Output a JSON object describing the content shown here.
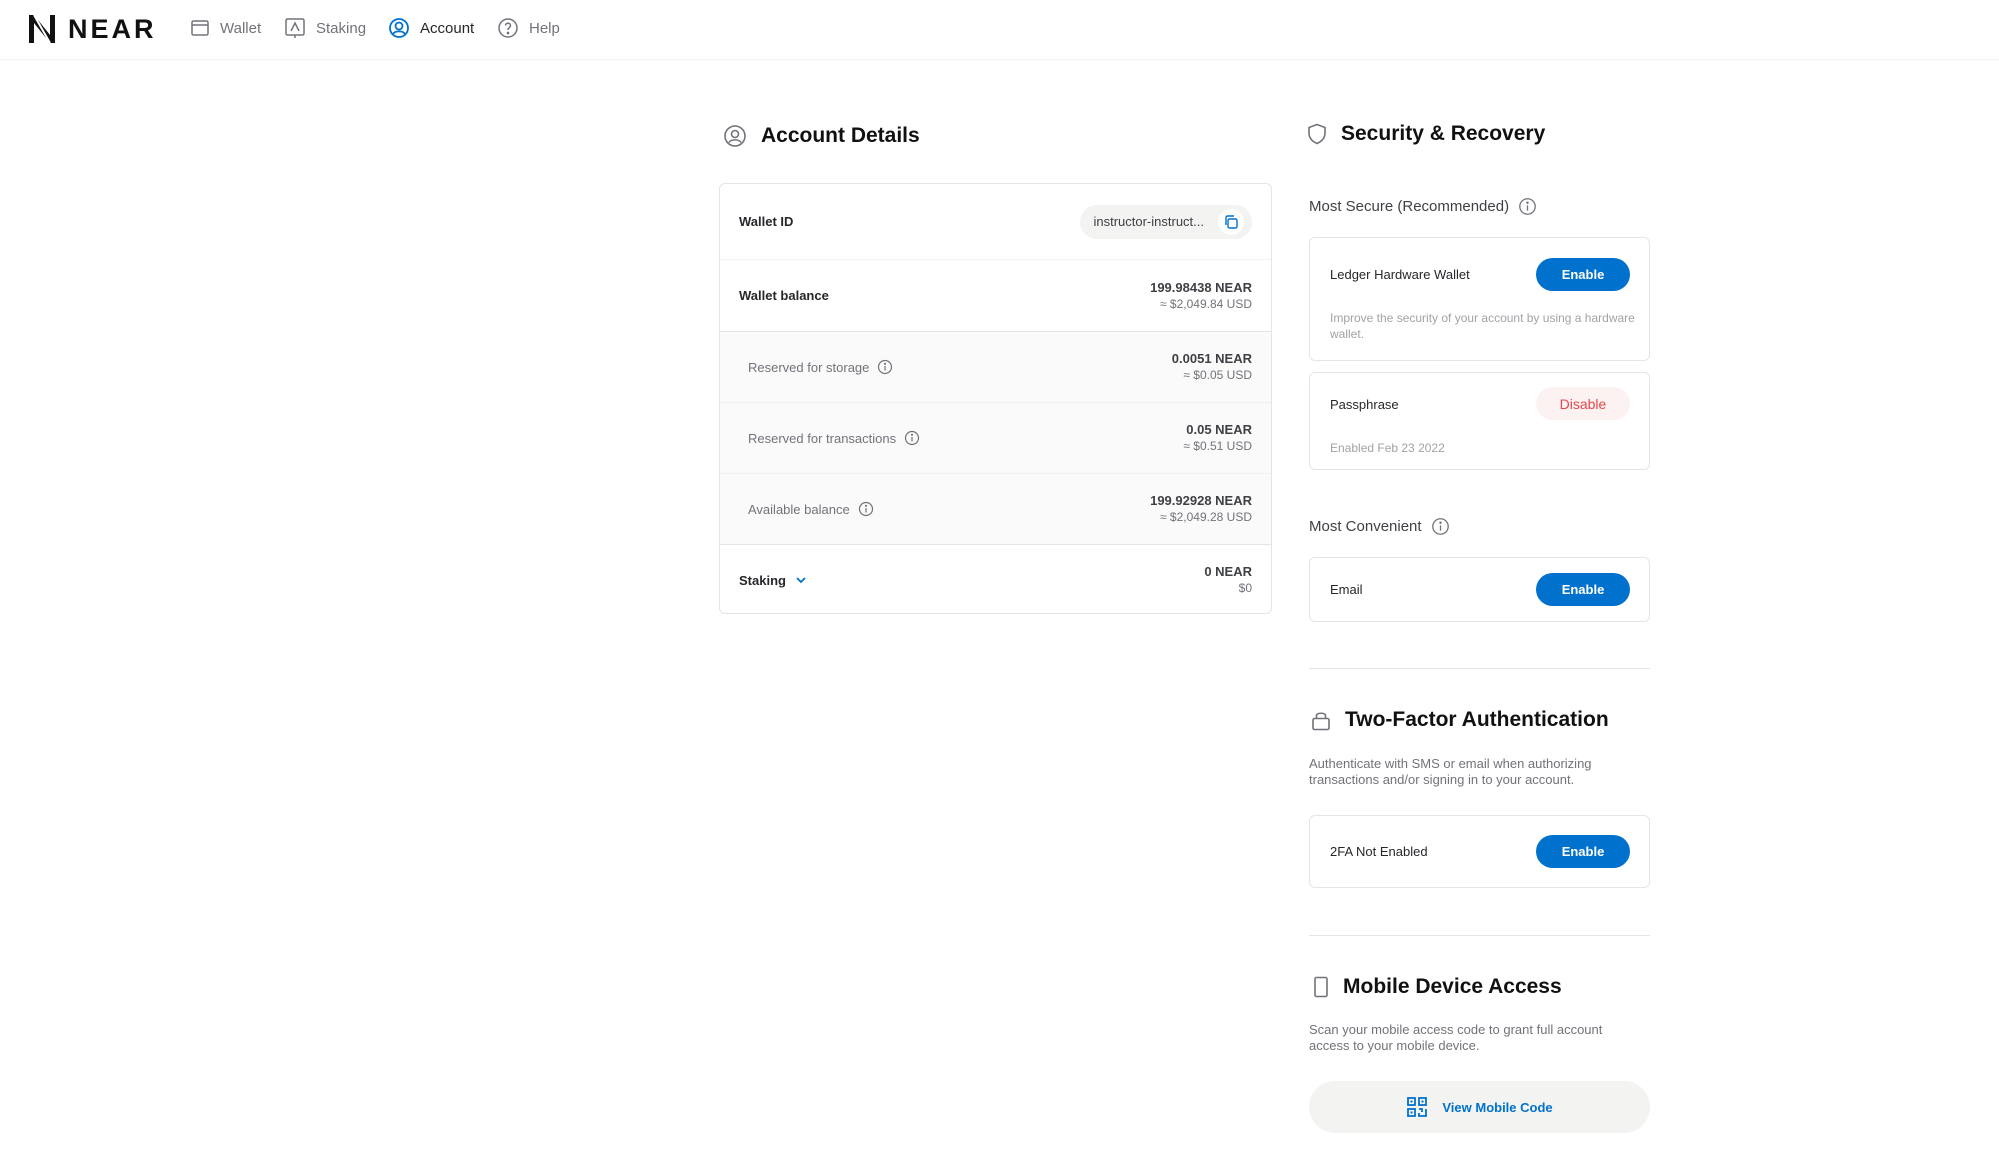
{
  "brand": {
    "logo_text": "NEAR"
  },
  "nav": {
    "wallet": "Wallet",
    "staking": "Staking",
    "account": "Account",
    "help": "Help"
  },
  "account_details": {
    "title": "Account Details",
    "wallet_id_label": "Wallet ID",
    "wallet_id_value": "instructor-instruct...",
    "rows": [
      {
        "label": "Wallet balance",
        "near": "199.98438 NEAR",
        "usd": "≈ $2,049.84 USD"
      },
      {
        "label": "Reserved for storage",
        "near": "0.0051 NEAR",
        "usd": "≈ $0.05 USD"
      },
      {
        "label": "Reserved for transactions",
        "near": "0.05 NEAR",
        "usd": "≈ $0.51 USD"
      },
      {
        "label": "Available balance",
        "near": "199.92928 NEAR",
        "usd": "≈ $2,049.28 USD"
      },
      {
        "label": "Staking",
        "near": "0 NEAR",
        "usd": "$0"
      }
    ]
  },
  "security": {
    "title": "Security & Recovery",
    "most_secure": "Most Secure (Recommended)",
    "ledger_title": "Ledger Hardware Wallet",
    "ledger_button": "Enable",
    "ledger_desc": "Improve the security of your account by using a hardware wallet.",
    "passphrase_title": "Passphrase",
    "passphrase_button": "Disable",
    "passphrase_desc": "Enabled Feb 23 2022",
    "most_convenient": "Most Convenient",
    "email_title": "Email",
    "email_button": "Enable"
  },
  "two_factor": {
    "title": "Two-Factor Authentication",
    "desc": "Authenticate with SMS or email when authorizing transactions and/or signing in to your account.",
    "status": "2FA Not Enabled",
    "button": "Enable"
  },
  "mobile": {
    "title": "Mobile Device Access",
    "desc": "Scan your mobile access code to grant full account access to your mobile device.",
    "button": "View Mobile Code"
  },
  "colors": {
    "accent": "#0072ce",
    "danger": "#e5484d",
    "text": "#25272a",
    "muted": "#72727a"
  },
  "icons": [
    "near-logo-icon",
    "wallet-icon",
    "staking-icon",
    "account-icon",
    "help-icon",
    "user-circle-icon",
    "copy-icon",
    "info-icon",
    "chevron-down-icon",
    "shield-icon",
    "lock-icon",
    "phone-icon",
    "qr-code-icon"
  ]
}
